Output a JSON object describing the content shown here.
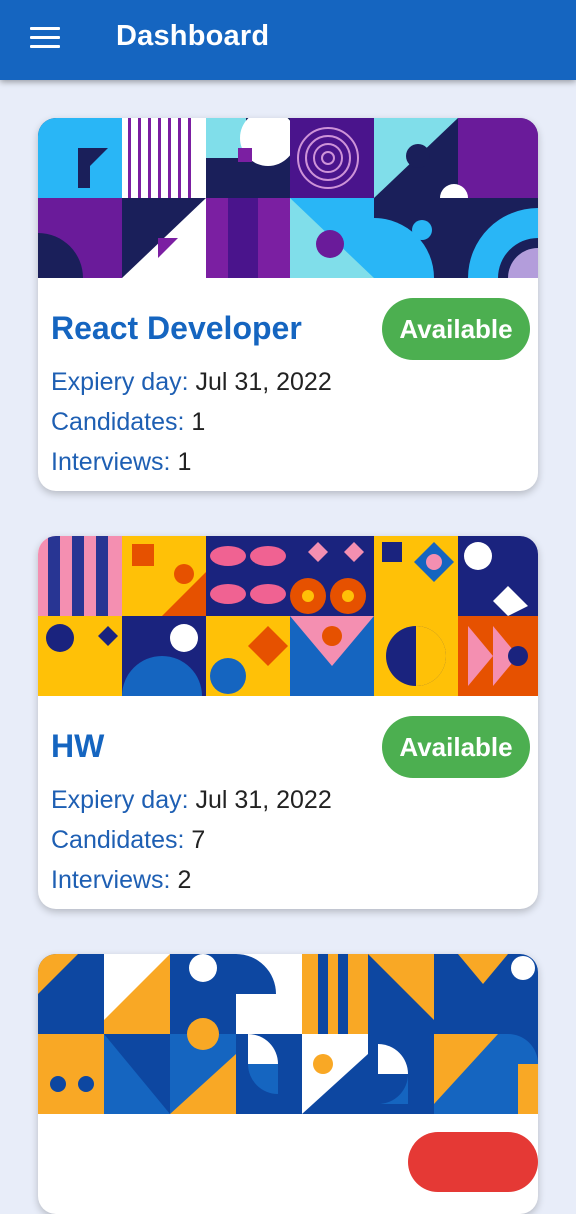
{
  "appbar": {
    "title": "Dashboard",
    "menu_icon": "hamburger-menu-icon"
  },
  "labels": {
    "expiry": "Expiery day:",
    "candidates": "Candidates:",
    "interviews": "Interviews:"
  },
  "jobs": [
    {
      "title": "React Developer",
      "status": "Available",
      "expiry": "Jul 31, 2022",
      "candidates": "1",
      "interviews": "1",
      "status_color": "#4caf50"
    },
    {
      "title": "HW",
      "status": "Available",
      "expiry": "Jul 31, 2022",
      "candidates": "7",
      "interviews": "2",
      "status_color": "#4caf50"
    }
  ],
  "colors": {
    "primary": "#1565c0",
    "background": "#e8edf9",
    "available": "#4caf50",
    "unavailable": "#e53935"
  }
}
